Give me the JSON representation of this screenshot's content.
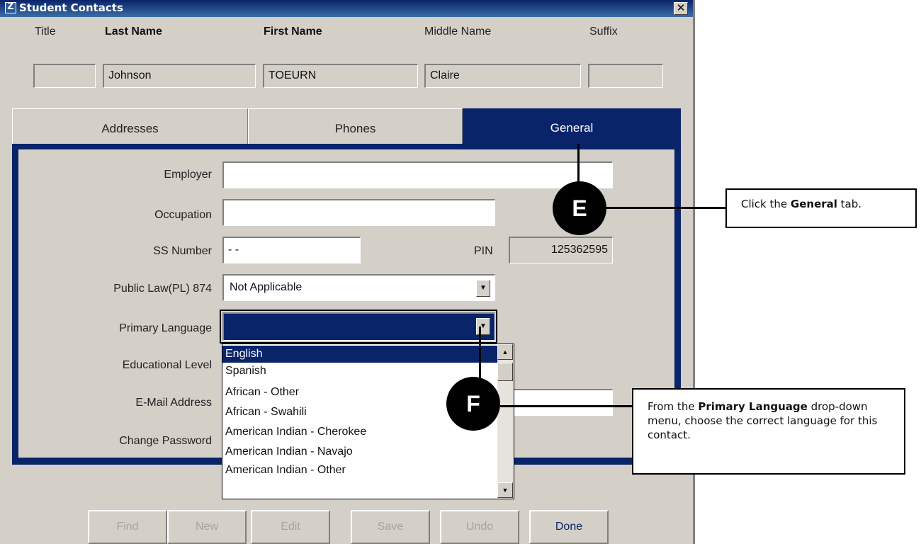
{
  "window": {
    "title": "Student Contacts",
    "close_glyph": "✕"
  },
  "name_header": {
    "title_label": "Title",
    "last_name_label": "Last Name",
    "first_name_label": "First Name",
    "middle_name_label": "Middle Name",
    "suffix_label": "Suffix",
    "title_value": "",
    "last_name_value": "Johnson",
    "first_name_value": "TOEURN",
    "middle_name_value": "Claire",
    "suffix_value": ""
  },
  "tabs": [
    {
      "label": "Addresses"
    },
    {
      "label": "Phones"
    },
    {
      "label": "General",
      "active": true
    }
  ],
  "general": {
    "employer_label": "Employer",
    "employer_value": "",
    "occupation_label": "Occupation",
    "occupation_value": "",
    "ss_label": "SS Number",
    "ss_value": "- -",
    "pin_label": "PIN",
    "pin_value": "125362595",
    "pl_label": "Public Law(PL) 874",
    "pl_value": "Not Applicable",
    "language_label": "Primary Language",
    "language_value": "",
    "edu_label": "Educational Level",
    "email_label": "E-Mail Address",
    "email_value": "",
    "password_label": "Change Password"
  },
  "language_options": [
    "English",
    "Spanish",
    "African - Other",
    "African - Swahili",
    "American Indian - Cherokee",
    "American Indian - Navajo",
    "American Indian - Other"
  ],
  "language_selected_index": 0,
  "buttons": {
    "find": "Find",
    "new": "New",
    "edit": "Edit",
    "save": "Save",
    "undo": "Undo",
    "done": "Done"
  },
  "callouts": {
    "e_letter": "E",
    "e_text_pre": "Click the ",
    "e_text_bold": "General",
    "e_text_post": " tab.",
    "f_letter": "F",
    "f_text_pre": "From the ",
    "f_text_bold": "Primary Language",
    "f_text_post": " drop-down menu, choose the correct language for this contact."
  },
  "colors": {
    "window_face": "#d4d0c8",
    "selection_navy": "#0a246a",
    "callout_black": "#000000"
  }
}
